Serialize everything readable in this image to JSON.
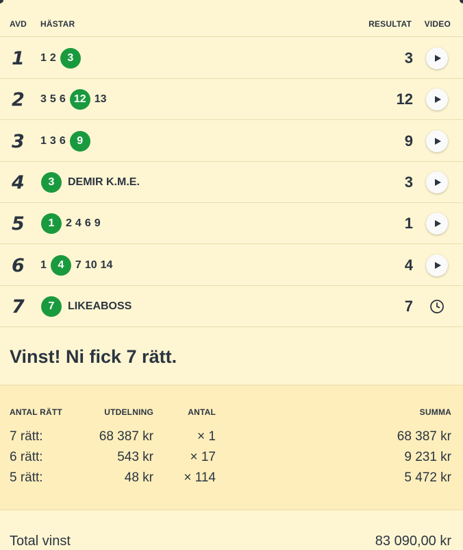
{
  "header": {
    "avd": "AVD",
    "hastar": "HÄSTAR",
    "resultat": "RESULTAT",
    "video": "VIDEO"
  },
  "races": [
    {
      "avd": "1",
      "horses": [
        {
          "n": "1",
          "win": false
        },
        {
          "n": "2",
          "win": false
        },
        {
          "n": "3",
          "win": true
        }
      ],
      "name": "",
      "result": "3",
      "action": "play"
    },
    {
      "avd": "2",
      "horses": [
        {
          "n": "3",
          "win": false
        },
        {
          "n": "5",
          "win": false
        },
        {
          "n": "6",
          "win": false
        },
        {
          "n": "12",
          "win": true
        },
        {
          "n": "13",
          "win": false
        }
      ],
      "name": "",
      "result": "12",
      "action": "play"
    },
    {
      "avd": "3",
      "horses": [
        {
          "n": "1",
          "win": false
        },
        {
          "n": "3",
          "win": false
        },
        {
          "n": "6",
          "win": false
        },
        {
          "n": "9",
          "win": true
        }
      ],
      "name": "",
      "result": "9",
      "action": "play"
    },
    {
      "avd": "4",
      "horses": [
        {
          "n": "3",
          "win": true
        }
      ],
      "name": "DEMIR K.M.E.",
      "result": "3",
      "action": "play"
    },
    {
      "avd": "5",
      "horses": [
        {
          "n": "1",
          "win": true
        },
        {
          "n": "2",
          "win": false
        },
        {
          "n": "4",
          "win": false
        },
        {
          "n": "6",
          "win": false
        },
        {
          "n": "9",
          "win": false
        }
      ],
      "name": "",
      "result": "1",
      "action": "play"
    },
    {
      "avd": "6",
      "horses": [
        {
          "n": "1",
          "win": false
        },
        {
          "n": "4",
          "win": true
        },
        {
          "n": "7",
          "win": false
        },
        {
          "n": "10",
          "win": false
        },
        {
          "n": "14",
          "win": false
        }
      ],
      "name": "",
      "result": "4",
      "action": "play"
    },
    {
      "avd": "7",
      "horses": [
        {
          "n": "7",
          "win": true
        }
      ],
      "name": "LIKEABOSS",
      "result": "7",
      "action": "clock"
    }
  ],
  "message": "Vinst! Ni fick 7 rätt.",
  "payout": {
    "headers": {
      "antal_ratt": "ANTAL RÄTT",
      "utdelning": "UTDELNING",
      "antal": "ANTAL",
      "summa": "SUMMA"
    },
    "rows": [
      {
        "ratt": "7 rätt:",
        "utdelning": "68 387 kr",
        "antal": "× 1",
        "summa": "68 387 kr"
      },
      {
        "ratt": "6 rätt:",
        "utdelning": "543 kr",
        "antal": "× 17",
        "summa": "9 231 kr"
      },
      {
        "ratt": "5 rätt:",
        "utdelning": "48 kr",
        "antal": "× 114",
        "summa": "5 472 kr"
      }
    ]
  },
  "total": {
    "label": "Total vinst",
    "value": "83 090,00 kr"
  },
  "colors": {
    "background": "#fef6d2",
    "payout_background": "#fdeebc",
    "win_badge": "#1a9a3e",
    "text": "#2b3440"
  },
  "icons": {
    "play": "play-icon",
    "clock": "clock-icon"
  }
}
